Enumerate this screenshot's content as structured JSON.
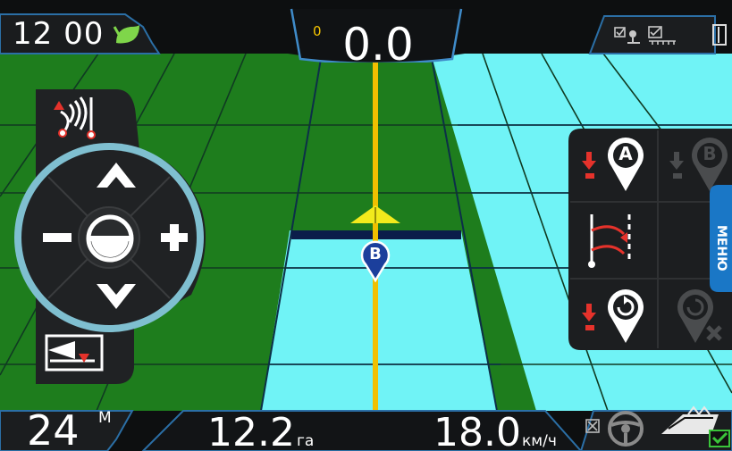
{
  "header": {
    "time": "12 00",
    "cross_track_error": "0.0",
    "cross_track_indicator": "0"
  },
  "footer": {
    "swath_width_value": "24",
    "swath_width_unit": "М",
    "area_value": "12.2",
    "area_unit": "га",
    "speed_value": "18.0",
    "speed_unit": "км/ч"
  },
  "map": {
    "b_marker_label": "B"
  },
  "right_panel": {
    "set_a_point_label": "A",
    "set_b_point_label": "B",
    "menu_label": "МЕНЮ"
  },
  "colors": {
    "field_green": "#1f7f1e",
    "coverage_cyan": "#6ff3f5",
    "guideline_yellow": "#f2c300",
    "panel_dark": "#1b1b1b",
    "accent_blue": "#1a77c6"
  }
}
